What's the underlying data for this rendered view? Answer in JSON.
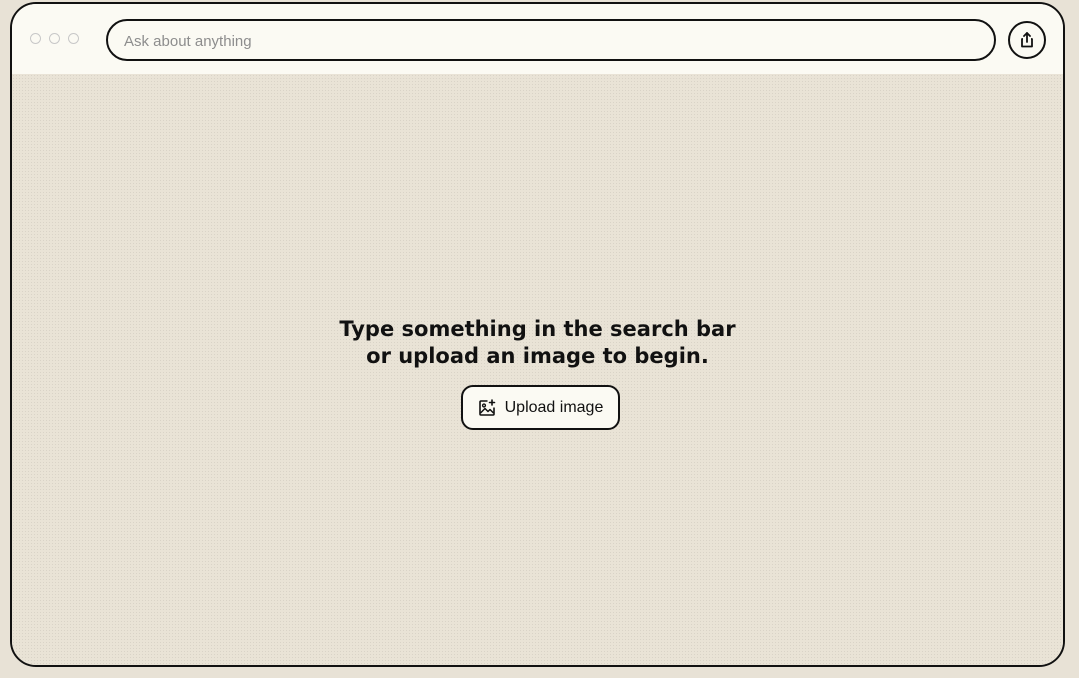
{
  "toolbar": {
    "window_controls": [
      "close-dot",
      "minimize-dot",
      "maximize-dot"
    ],
    "search": {
      "placeholder": "Ask about anything",
      "value": ""
    },
    "share_icon": "share-upload-icon"
  },
  "main": {
    "prompt_line1": "Type something in the search bar",
    "prompt_line2": "or upload an image to begin.",
    "upload_button": {
      "label": "Upload image",
      "icon": "image-add-icon"
    }
  },
  "colors": {
    "background": "#e9e3d6",
    "topbar": "#fbfaf3",
    "border": "#111111",
    "placeholder": "#8d8d8d"
  }
}
